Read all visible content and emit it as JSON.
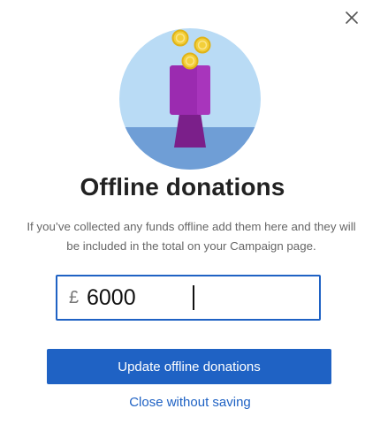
{
  "dialog": {
    "title": "Offline donations",
    "description": "If you’ve collected any funds offline add them here and they will be included in the total on your Campaign page.",
    "close_icon": "close-icon",
    "illustration_icon": "donation-box-with-coins-illustration"
  },
  "amount_field": {
    "currency_symbol": "£",
    "value": "6000"
  },
  "actions": {
    "update_label": "Update offline donations",
    "close_label": "Close without saving"
  },
  "colors": {
    "accent": "#1f62c4",
    "title_text": "#222222",
    "description_text": "#666666",
    "illustration_sky": "#b9dbf5",
    "illustration_ground": "#6f9ed6",
    "box_purple": "#9b2bb0",
    "stand_purple": "#7b1f8a",
    "coin_gold": "#f3cf3a"
  }
}
